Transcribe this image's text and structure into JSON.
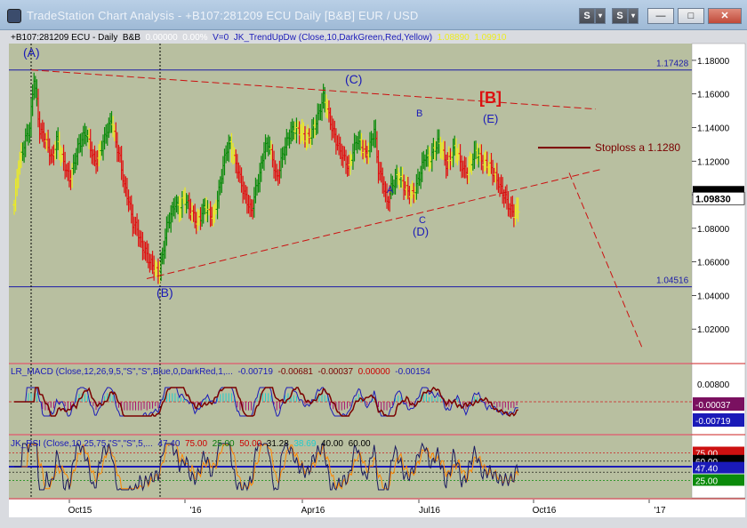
{
  "window": {
    "title": "TradeStation Chart Analysis - +B107:281209 ECU Daily [B&B] EUR / USD",
    "buttons": [
      "S",
      "▾",
      "S",
      "▾"
    ],
    "controls": {
      "minimize": "—",
      "maximize": "□",
      "close": "✕"
    }
  },
  "info_line": {
    "symbol": "+B107:281209 ECU - Daily",
    "tag": "B&B",
    "v1": "0.00000",
    "v2": "0.00%",
    "v3": "V=0",
    "indicator": "JK_TrendUpDw (Close,10,DarkGreen,Red,Yellow)",
    "val1": "1.08890",
    "val2": "1.09910"
  },
  "price_axis": {
    "ticks": [
      "1.18000",
      "1.16000",
      "1.14000",
      "1.12000",
      "1.10000",
      "1.08000",
      "1.06000",
      "1.04000",
      "1.02000"
    ],
    "last": "1.09830",
    "hline_labels": [
      "1.17428",
      "1.04516"
    ]
  },
  "annotations": {
    "waves": [
      "(A)",
      "(B)",
      "(C)",
      "(D)",
      "(E)",
      "[B]",
      "A",
      "B",
      "C"
    ],
    "stoploss": "Stoploss a 1.1280"
  },
  "macd": {
    "title": "LR_MACD (Close,12,26,9,5,\"S\",\"S\",Blue,0,DarkRed,1,...",
    "values": [
      "-0.00719",
      "-0.00681",
      "-0.00037",
      "0.00000",
      "-0.00154"
    ],
    "axis": [
      "0.00800"
    ],
    "badges": [
      "-0.00037",
      "-0.00719"
    ]
  },
  "rsi": {
    "title": "JK_RSI (Close,10,25,75,\"S\",\"S\",5,...",
    "values": [
      "47.40",
      "75.00",
      "25.00",
      "50.00",
      "31.28",
      "38.69",
      "40.00",
      "60.00"
    ],
    "badges": [
      "75.00",
      "60.00",
      "47.40",
      "25.00"
    ]
  },
  "time_axis": {
    "labels": [
      "Oct15",
      "'16",
      "Apr16",
      "Jul16",
      "Oct16",
      "'17"
    ]
  },
  "colors": {
    "bg": "#b8bfa0",
    "up": "#0a8a0a",
    "down": "#e01010",
    "neutral": "#ecec20",
    "hline": "#1a1aa8",
    "wave": "#1a1ab8",
    "trend": "#cc1010"
  },
  "chart_data": {
    "type": "ohlc",
    "price_points": [
      [
        0,
        1.094
      ],
      [
        3,
        1.118
      ],
      [
        6,
        1.126
      ],
      [
        8,
        1.133
      ],
      [
        11,
        1.14
      ],
      [
        14,
        1.17
      ],
      [
        16,
        1.155
      ],
      [
        18,
        1.138
      ],
      [
        21,
        1.135
      ],
      [
        24,
        1.128
      ],
      [
        27,
        1.121
      ],
      [
        30,
        1.133
      ],
      [
        33,
        1.124
      ],
      [
        36,
        1.117
      ],
      [
        39,
        1.109
      ],
      [
        42,
        1.117
      ],
      [
        45,
        1.128
      ],
      [
        48,
        1.133
      ],
      [
        51,
        1.137
      ],
      [
        54,
        1.128
      ],
      [
        57,
        1.119
      ],
      [
        60,
        1.124
      ],
      [
        63,
        1.131
      ],
      [
        66,
        1.139
      ],
      [
        69,
        1.144
      ],
      [
        72,
        1.131
      ],
      [
        75,
        1.121
      ],
      [
        78,
        1.105
      ],
      [
        81,
        1.097
      ],
      [
        84,
        1.083
      ],
      [
        87,
        1.08
      ],
      [
        90,
        1.07
      ],
      [
        93,
        1.066
      ],
      [
        96,
        1.06
      ],
      [
        99,
        1.057
      ],
      [
        102,
        1.053
      ],
      [
        105,
        1.063
      ],
      [
        108,
        1.081
      ],
      [
        111,
        1.088
      ],
      [
        114,
        1.095
      ],
      [
        117,
        1.091
      ],
      [
        120,
        1.098
      ],
      [
        123,
        1.094
      ],
      [
        126,
        1.089
      ],
      [
        129,
        1.084
      ],
      [
        132,
        1.087
      ],
      [
        135,
        1.093
      ],
      [
        138,
        1.089
      ],
      [
        141,
        1.087
      ],
      [
        144,
        1.097
      ],
      [
        147,
        1.112
      ],
      [
        150,
        1.126
      ],
      [
        153,
        1.13
      ],
      [
        156,
        1.121
      ],
      [
        159,
        1.113
      ],
      [
        162,
        1.103
      ],
      [
        165,
        1.096
      ],
      [
        168,
        1.09
      ],
      [
        171,
        1.103
      ],
      [
        174,
        1.112
      ],
      [
        177,
        1.127
      ],
      [
        180,
        1.131
      ],
      [
        183,
        1.121
      ],
      [
        186,
        1.109
      ],
      [
        189,
        1.12
      ],
      [
        192,
        1.129
      ],
      [
        195,
        1.136
      ],
      [
        198,
        1.139
      ],
      [
        201,
        1.138
      ],
      [
        204,
        1.137
      ],
      [
        207,
        1.133
      ],
      [
        210,
        1.136
      ],
      [
        213,
        1.141
      ],
      [
        216,
        1.149
      ],
      [
        219,
        1.158
      ],
      [
        222,
        1.15
      ],
      [
        225,
        1.14
      ],
      [
        228,
        1.132
      ],
      [
        231,
        1.126
      ],
      [
        234,
        1.121
      ],
      [
        237,
        1.116
      ],
      [
        240,
        1.126
      ],
      [
        243,
        1.133
      ],
      [
        246,
        1.129
      ],
      [
        249,
        1.124
      ],
      [
        252,
        1.129
      ],
      [
        255,
        1.139
      ],
      [
        258,
        1.115
      ],
      [
        261,
        1.108
      ],
      [
        264,
        1.095
      ],
      [
        267,
        1.104
      ],
      [
        270,
        1.109
      ],
      [
        273,
        1.111
      ],
      [
        276,
        1.105
      ],
      [
        279,
        1.102
      ],
      [
        282,
        1.1
      ],
      [
        285,
        1.105
      ],
      [
        288,
        1.114
      ],
      [
        291,
        1.123
      ],
      [
        294,
        1.12
      ],
      [
        297,
        1.126
      ],
      [
        300,
        1.131
      ],
      [
        303,
        1.127
      ],
      [
        306,
        1.118
      ],
      [
        309,
        1.122
      ],
      [
        312,
        1.128
      ],
      [
        315,
        1.122
      ],
      [
        318,
        1.115
      ],
      [
        321,
        1.114
      ],
      [
        324,
        1.12
      ],
      [
        327,
        1.126
      ],
      [
        330,
        1.122
      ],
      [
        333,
        1.119
      ],
      [
        336,
        1.118
      ],
      [
        339,
        1.114
      ],
      [
        342,
        1.109
      ],
      [
        345,
        1.103
      ],
      [
        348,
        1.098
      ],
      [
        351,
        1.092
      ],
      [
        354,
        1.089
      ],
      [
        357,
        1.091
      ]
    ],
    "time_axis_labels": [
      "Oct15",
      "'16",
      "Apr16",
      "Jul16",
      "Oct16",
      "'17"
    ],
    "ylim": [
      1.0,
      1.19
    ],
    "horizontal_levels": [
      1.17428,
      1.04516
    ],
    "last_price": 1.0983,
    "stoploss": 1.128
  }
}
